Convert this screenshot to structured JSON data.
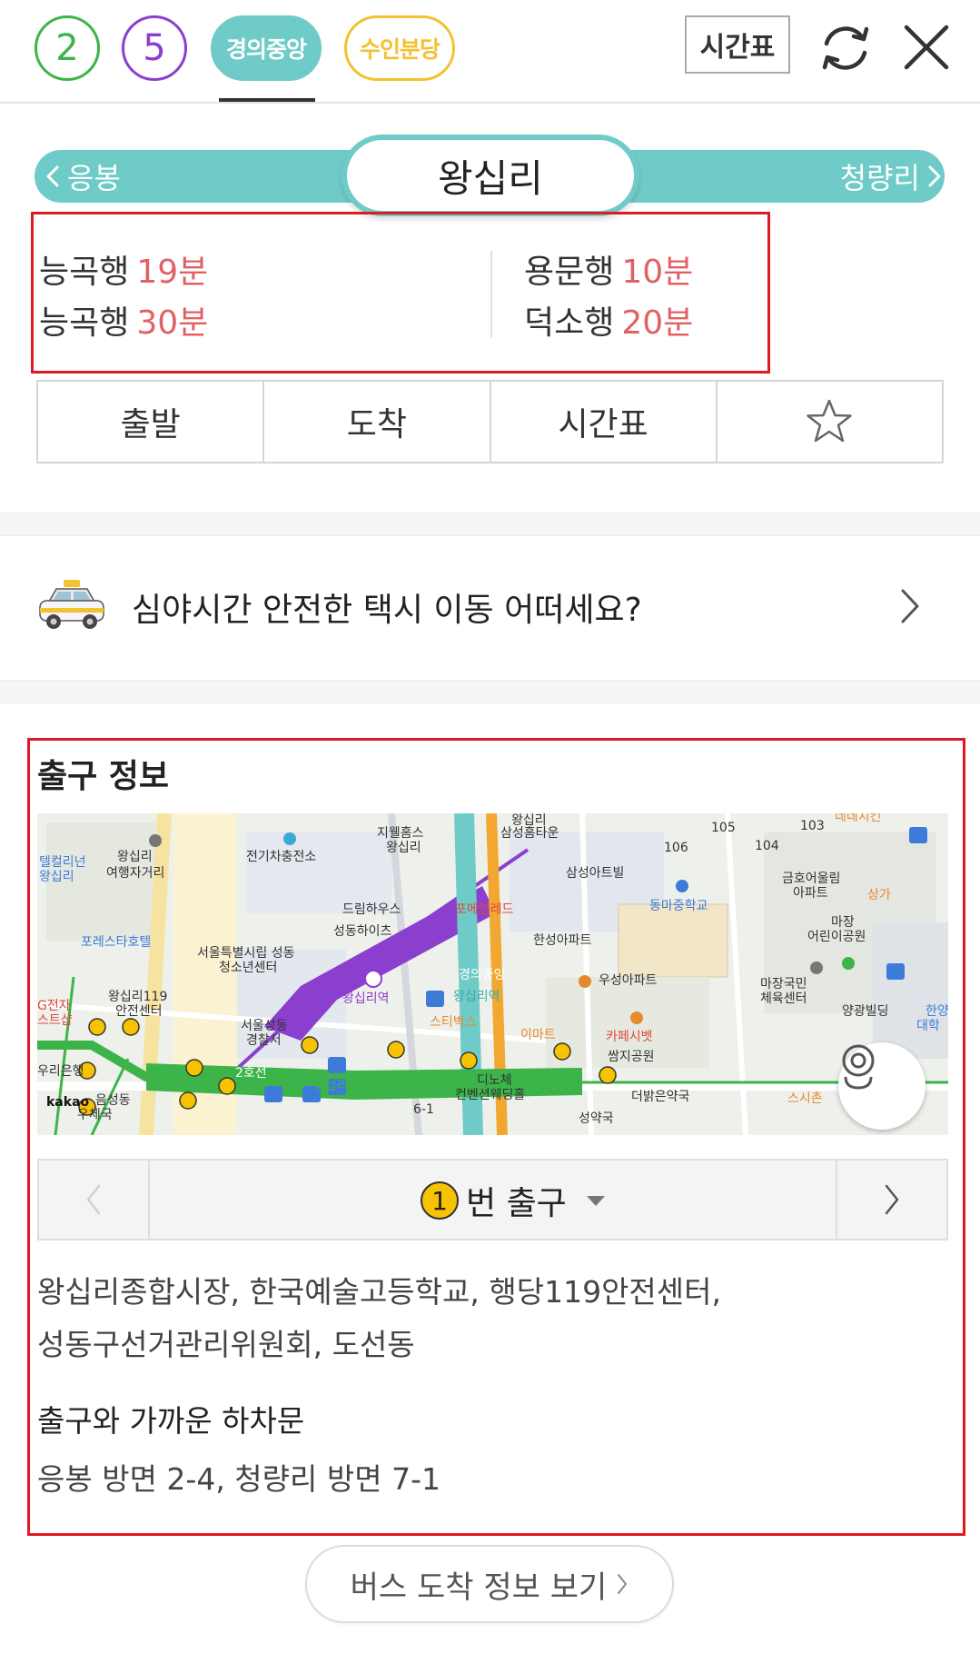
{
  "lines": {
    "line2": "2",
    "line5": "5",
    "gyeongui": "경의중앙",
    "suin": "수인분당"
  },
  "header": {
    "timetable_label": "시간표"
  },
  "station": {
    "name": "왕십리",
    "prev": "응봉",
    "next": "청량리"
  },
  "arrivals": [
    {
      "dest": "능곡행",
      "time": "19분"
    },
    {
      "dest": "능곡행",
      "time": "30분"
    },
    {
      "dest": "용문행",
      "time": "10분"
    },
    {
      "dest": "덕소행",
      "time": "20분"
    }
  ],
  "actions": {
    "depart": "출발",
    "arrive": "도착",
    "timetable": "시간표"
  },
  "taxi_banner": {
    "text": "심야시간 안전한 택시 이동 어떠세요?"
  },
  "exit_info": {
    "title": "출구 정보",
    "exit_number": "1",
    "exit_suffix": "번 출구",
    "places_line1": "왕십리종합시장, 한국예술고등학교, 행당119안전센터,",
    "places_line2": "성동구선거관리위원회, 도선동",
    "stop_title": "출구와 가까운 하차문",
    "stop_info": "응봉 방면 2-4, 청량리 방면 7-1"
  },
  "map": {
    "labels": {
      "l1": "왕십리",
      "l2": "삼성홈타운",
      "l3": "지웰홈스",
      "l4": "왕십리",
      "l5": "전기차충전소",
      "l6": "왕십리",
      "l7": "여행자거리",
      "l8": "텔컬리넌",
      "l9": "왕십리",
      "l10": "삼성아트빌",
      "l11": "드림하우스",
      "l12": "포메인레드",
      "l13": "동마중학교",
      "l14": "금호어울림",
      "l15": "아파트",
      "l16": "상가",
      "l17": "성동하이츠",
      "l18": "한성아파트",
      "l19": "마장",
      "l20": "어린이공원",
      "l21": "포레스타호텔",
      "l22": "서울특별시립 성동",
      "l23": "청소년센터",
      "l24": "왕십리역",
      "l25": "경의중앙",
      "l26": "왕십리역",
      "l27": "우성아파트",
      "l28": "마장국민",
      "l29": "체육센터",
      "l30": "양광빌딩",
      "l31": "한양",
      "l32": "대학",
      "l33": "왕십리119",
      "l34": "안전센터",
      "l35": "서울성동",
      "l36": "경찰서",
      "l37": "스티벅스",
      "l38": "이마트",
      "l39": "카페시벳",
      "l40": "쌈지공원",
      "l41": "우리은행",
      "l42": "2호선",
      "l43": "왕십리역",
      "l44": "디노체",
      "l45": "컨벤션웨딩홀",
      "l46": "더밝은약국",
      "l47": "스시촌",
      "l48": "kakao",
      "l49": "음성동",
      "l50": "우체국",
      "l51": "성약국",
      "l52": "G전자",
      "l53": "스트샵",
      "l54": "105",
      "l55": "106",
      "l56": "104",
      "l57": "103",
      "l58": "네네치킨",
      "l59": "6-1"
    }
  },
  "bus_button": {
    "label": "버스 도착 정보 보기"
  },
  "colors": {
    "line2": "#3cb44a",
    "line5": "#8b3fcf",
    "gyeongui": "#6ecbc7",
    "suin": "#f2c230",
    "arrival_time": "#e26063",
    "highlight_border": "#e01a22"
  }
}
